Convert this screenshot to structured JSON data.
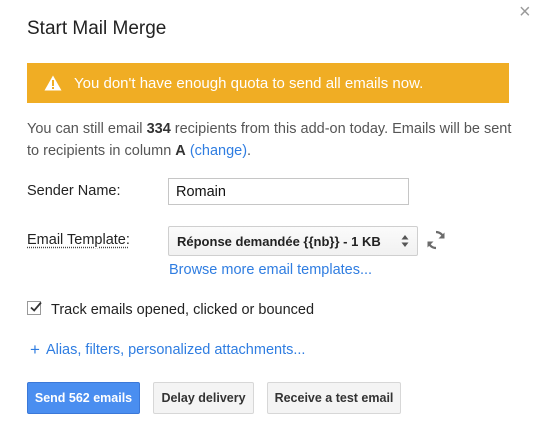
{
  "dialog": {
    "title": "Start Mail Merge",
    "close_icon": "×"
  },
  "warning": {
    "icon": "warning-icon",
    "text": "You don't have enough quota to send all emails now.",
    "color": "#f0ad24"
  },
  "info": {
    "prefix": "You can still email ",
    "count": "334",
    "middle": " recipients from this add-on today. Emails will be sent to recipients in column ",
    "column": "A",
    "change_link": "(change)",
    "suffix": "."
  },
  "sender": {
    "label": "Sender Name:",
    "value": "Romain"
  },
  "template": {
    "label": "Email Template:",
    "selected": "Réponse demandée {{nb}} - 1 KB",
    "browse_link": "Browse more email templates..."
  },
  "tracking": {
    "checked": true,
    "label": "Track emails opened, clicked or bounced"
  },
  "advanced": {
    "plus": "+",
    "link": "Alias, filters, personalized attachments..."
  },
  "buttons": {
    "send": "Send 562 emails",
    "delay": "Delay delivery",
    "test": "Receive a test email"
  },
  "colors": {
    "accent": "#4a8ef0",
    "link": "#2f7de1"
  }
}
